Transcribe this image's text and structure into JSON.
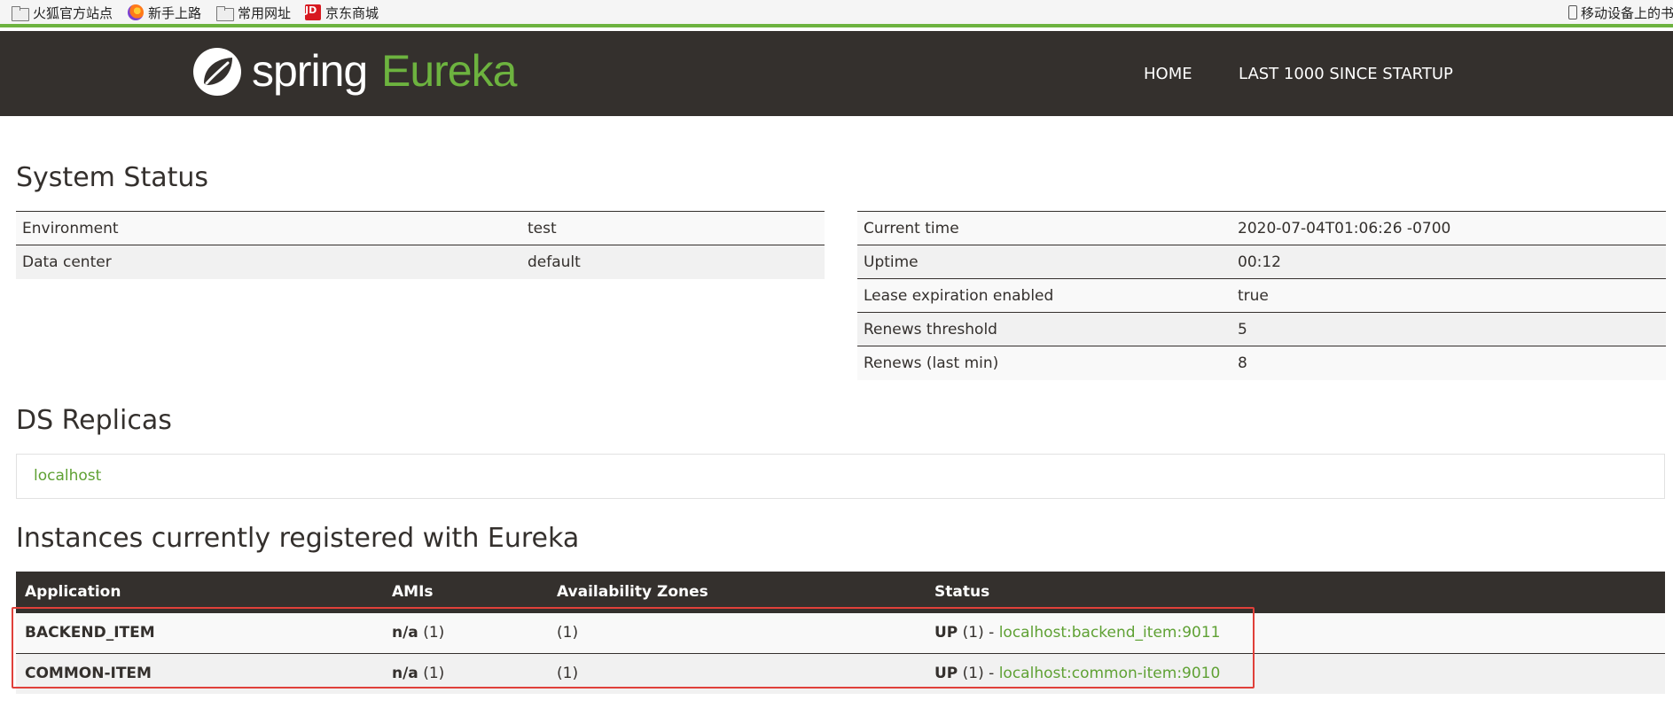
{
  "bookmarks": [
    {
      "label": "火狐官方站点",
      "icon": "folder-icon"
    },
    {
      "label": "新手上路",
      "icon": "firefox-icon"
    },
    {
      "label": "常用网址",
      "icon": "folder-icon"
    },
    {
      "label": "京东商城",
      "icon": "jd-icon"
    }
  ],
  "bookmarks_right": {
    "label": "移动设备上的书",
    "icon": "phone-icon"
  },
  "jd_icon_text": "JD",
  "brand": {
    "spring": "spring",
    "eureka": "Eureka",
    "accent": "#6db33f",
    "dark": "#34302d"
  },
  "nav": {
    "home": "HOME",
    "last1000": "LAST 1000 SINCE STARTUP"
  },
  "system_status": {
    "title": "System Status",
    "left": [
      {
        "key": "Environment",
        "value": "test"
      },
      {
        "key": "Data center",
        "value": "default"
      }
    ],
    "right": [
      {
        "key": "Current time",
        "value": "2020-07-04T01:06:26 -0700"
      },
      {
        "key": "Uptime",
        "value": "00:12"
      },
      {
        "key": "Lease expiration enabled",
        "value": "true"
      },
      {
        "key": "Renews threshold",
        "value": "5"
      },
      {
        "key": "Renews (last min)",
        "value": "8"
      }
    ]
  },
  "replicas": {
    "title": "DS Replicas",
    "host": "localhost"
  },
  "instances": {
    "title": "Instances currently registered with Eureka",
    "headers": [
      "Application",
      "AMIs",
      "Availability Zones",
      "Status"
    ],
    "rows": [
      {
        "app": "BACKEND_ITEM",
        "ami_bold": "n/a",
        "ami_count": "(1)",
        "zones": "(1)",
        "status_bold": "UP",
        "status_count": "(1) -",
        "link": "localhost:backend_item:9011"
      },
      {
        "app": "COMMON-ITEM",
        "ami_bold": "n/a",
        "ami_count": "(1)",
        "zones": "(1)",
        "status_bold": "UP",
        "status_count": "(1) -",
        "link": "localhost:common-item:9010"
      }
    ]
  }
}
